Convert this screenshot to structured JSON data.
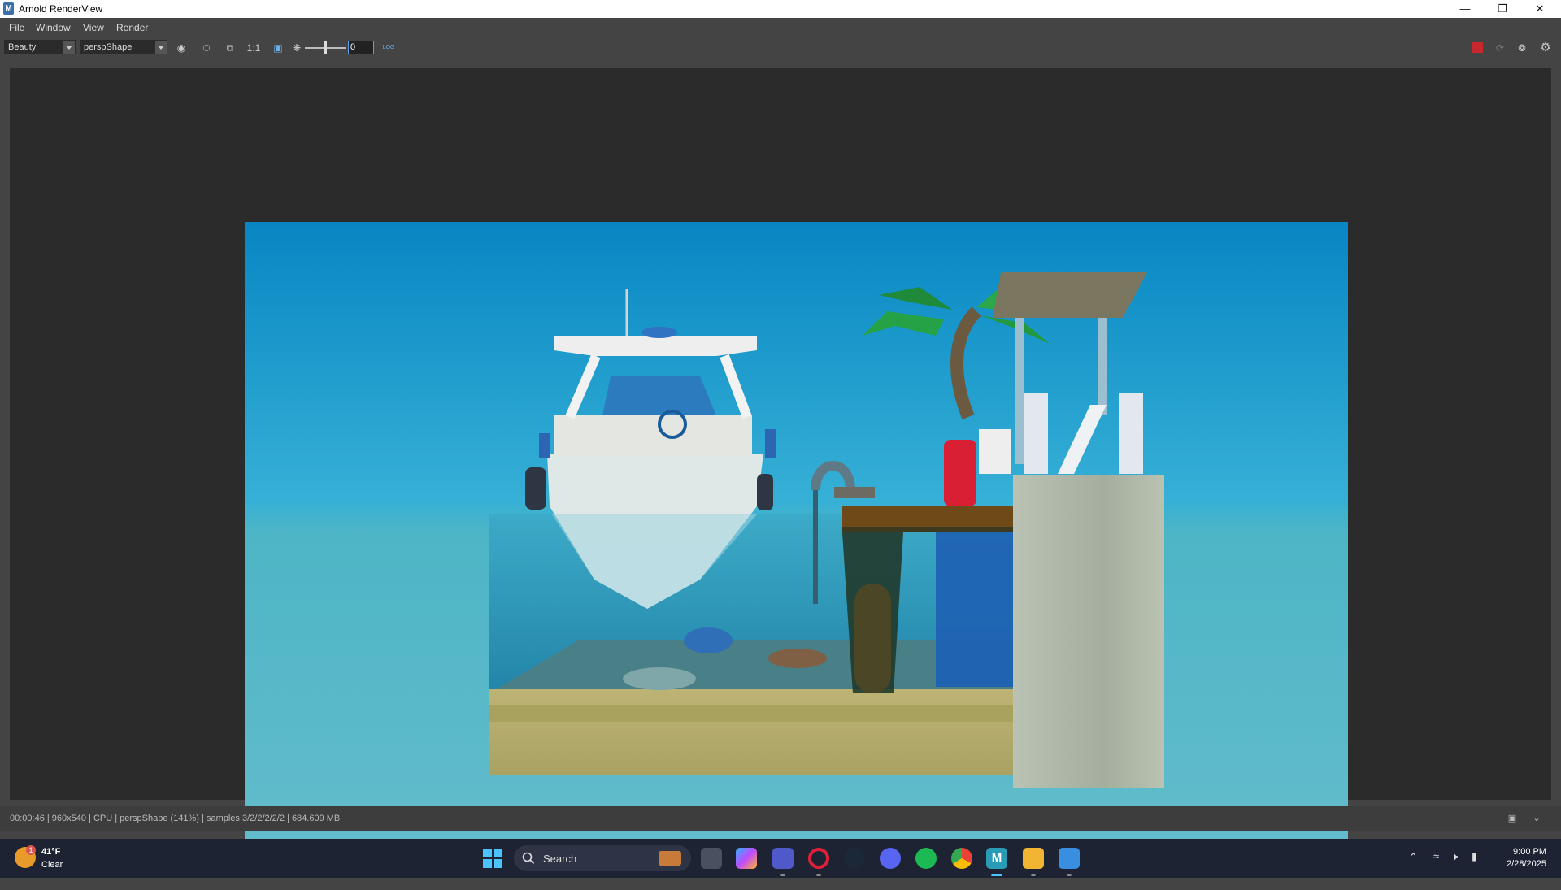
{
  "window": {
    "title": "Arnold RenderView",
    "app_icon_letter": "M",
    "controls": [
      "minimize",
      "restore",
      "close"
    ]
  },
  "menu": [
    "File",
    "Window",
    "View",
    "Render"
  ],
  "toolbar": {
    "aov_value": "Beauty",
    "camera_value": "perspShape",
    "one_to_one_label": "1:1",
    "exposure_value": "0",
    "log_label": "LOG"
  },
  "status": {
    "text": "00:00:46 | 960x540 | CPU | perspShape (141%) | samples 3/2/2/2/2/2 | 684.609 MB"
  },
  "taskbar": {
    "weather_temp": "41°F",
    "weather_cond": "Clear",
    "weather_badge": "1",
    "search_placeholder": "Search",
    "time": "9:00 PM",
    "date": "2/28/2025",
    "apps": [
      "task-view",
      "copilot",
      "teams",
      "opera",
      "steam",
      "discord",
      "spotify",
      "chrome",
      "maya",
      "file-explorer",
      "snipping-tool"
    ]
  },
  "colors": {
    "accent": "#4cc2ff",
    "stop_red": "#c8282d",
    "sky_top": "#0a86c4",
    "sky_bottom": "#5bbcd0"
  }
}
